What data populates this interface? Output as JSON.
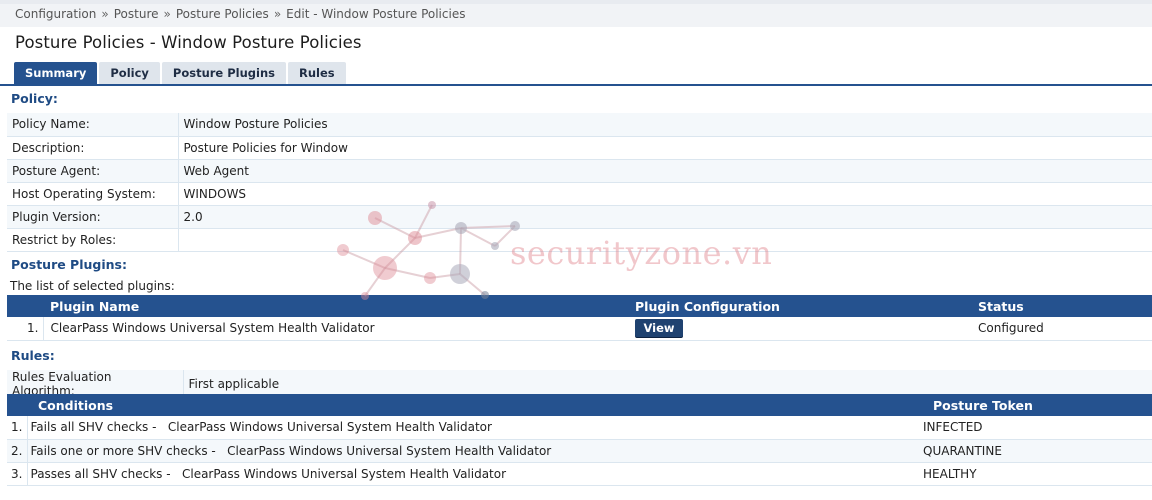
{
  "breadcrumb": [
    "Configuration",
    "Posture",
    "Posture Policies",
    "Edit - Window Posture Policies"
  ],
  "breadcrumb_separator": "»",
  "page_title": "Posture Policies - Window Posture Policies",
  "tabs": [
    {
      "label": "Summary",
      "active": true
    },
    {
      "label": "Policy",
      "active": false
    },
    {
      "label": "Posture Plugins",
      "active": false
    },
    {
      "label": "Rules",
      "active": false
    }
  ],
  "policy": {
    "heading": "Policy:",
    "rows": [
      {
        "key": "Policy Name:",
        "value": "Window Posture Policies"
      },
      {
        "key": "Description:",
        "value": "Posture Policies for Window"
      },
      {
        "key": "Posture Agent:",
        "value": "Web Agent"
      },
      {
        "key": "Host Operating System:",
        "value": "WINDOWS"
      },
      {
        "key": "Plugin Version:",
        "value": "2.0"
      },
      {
        "key": "Restrict by Roles:",
        "value": ""
      }
    ]
  },
  "plugins": {
    "heading": "Posture Plugins:",
    "intro": "The list of selected plugins:",
    "columns": [
      "Plugin Name",
      "Plugin Configuration",
      "Status"
    ],
    "rows": [
      {
        "num": "1.",
        "name": "ClearPass Windows Universal System Health Validator",
        "button": "View",
        "status": "Configured"
      }
    ]
  },
  "rules": {
    "heading": "Rules:",
    "algorithm_label": "Rules Evaluation Algorithm:",
    "algorithm_value": "First applicable",
    "columns": [
      "Conditions",
      "Posture Token"
    ],
    "rows": [
      {
        "num": "1.",
        "condition": "Fails all SHV checks -   ClearPass Windows Universal System Health Validator",
        "token": "INFECTED"
      },
      {
        "num": "2.",
        "condition": "Fails one or more SHV checks -   ClearPass Windows Universal System Health Validator",
        "token": "QUARANTINE"
      },
      {
        "num": "3.",
        "condition": "Passes all SHV checks -   ClearPass Windows Universal System Health Validator",
        "token": "HEALTHY"
      }
    ]
  },
  "watermark": "securityzone.vn",
  "colors": {
    "accent": "#25528f",
    "header_bg": "#25528f",
    "section_text": "#1f4b84"
  }
}
